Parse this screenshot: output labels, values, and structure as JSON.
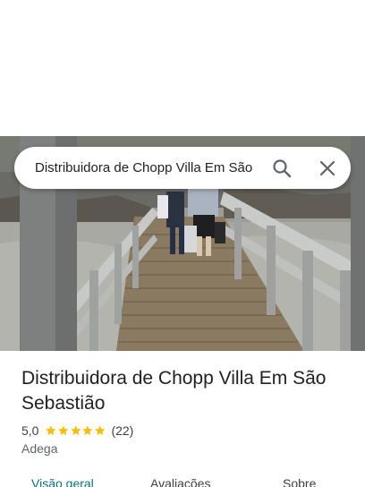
{
  "search": {
    "query": "Distribuidora de Chopp Villa Em São"
  },
  "place": {
    "name": "Distribuidora de Chopp Villa Em São Sebastião",
    "rating": "5,0",
    "stars": 5,
    "review_count": "(22)",
    "category": "Adega"
  },
  "tabs": [
    {
      "label": "Visão geral",
      "active": true
    },
    {
      "label": "Avaliações",
      "active": false
    },
    {
      "label": "Sobre",
      "active": false
    }
  ],
  "colors": {
    "star": "#fbbc04",
    "active_tab": "#0b7285",
    "icon": "#5f6368"
  },
  "icons": {
    "search": "search-icon",
    "close": "close-icon",
    "star": "star-icon"
  }
}
